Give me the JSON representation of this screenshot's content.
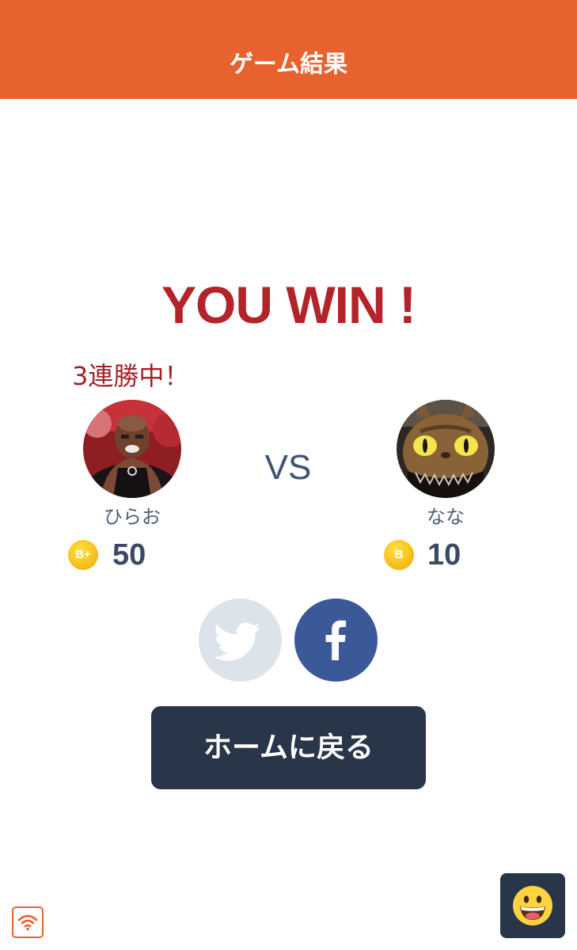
{
  "header": {
    "title": "ゲーム結果"
  },
  "result": {
    "text": "YOU WIN !"
  },
  "player_left": {
    "streak": "3連勝中！",
    "name": "ひらお",
    "rank": "B+",
    "score": "50"
  },
  "versus": {
    "label": "VS"
  },
  "player_right": {
    "name": "なな",
    "rank": "B",
    "score": "10"
  },
  "share": {
    "twitter_icon": "twitter-bird-icon",
    "facebook_icon": "facebook-f-icon"
  },
  "actions": {
    "home_label": "ホームに戻る"
  },
  "corner": {
    "wifi_icon": "wifi-icon",
    "emoji_icon": "smiley-face-icon"
  },
  "colors": {
    "header": "#E8622F",
    "win_text": "#B3232A",
    "dark_button": "#293548",
    "facebook": "#3B5999",
    "twitter_disabled": "#DCE3EA",
    "rank_gold": "#F7C21C"
  }
}
